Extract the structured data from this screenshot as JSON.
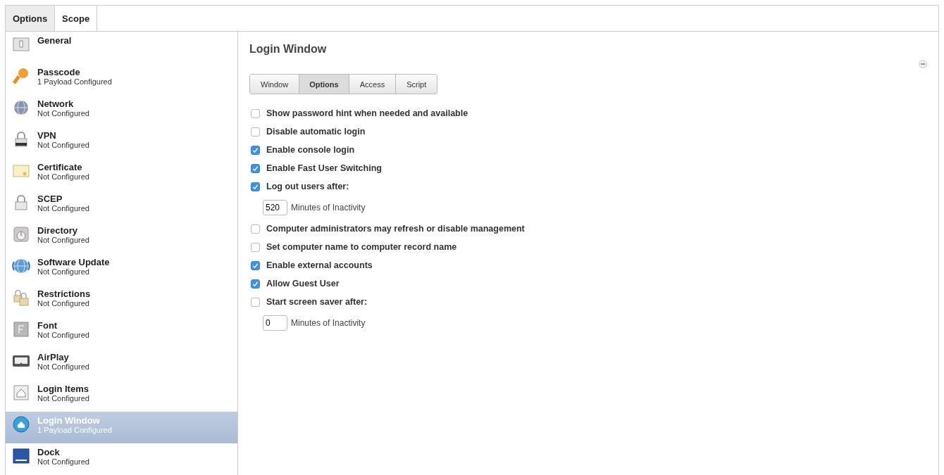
{
  "top_tabs": [
    {
      "label": "Options",
      "selected": true
    },
    {
      "label": "Scope",
      "selected": false
    }
  ],
  "sidebar": {
    "items": [
      {
        "name": "General",
        "selected": false
      },
      {
        "name": "Passcode",
        "status": "1 Payload Configured",
        "selected": false
      },
      {
        "name": "Network",
        "status": "Not Configured",
        "selected": false
      },
      {
        "name": "VPN",
        "status": "Not Configured",
        "selected": false
      },
      {
        "name": "Certificate",
        "status": "Not Configured",
        "selected": false
      },
      {
        "name": "SCEP",
        "status": "Not Configured",
        "selected": false
      },
      {
        "name": "Directory",
        "status": "Not Configured",
        "selected": false
      },
      {
        "name": "Software Update",
        "status": "Not Configured",
        "selected": false
      },
      {
        "name": "Restrictions",
        "status": "Not Configured",
        "selected": false
      },
      {
        "name": "Font",
        "status": "Not Configured",
        "selected": false
      },
      {
        "name": "AirPlay",
        "status": "Not Configured",
        "selected": false
      },
      {
        "name": "Login Items",
        "status": "Not Configured",
        "selected": false
      },
      {
        "name": "Login Window",
        "status": "1 Payload Configured",
        "selected": true
      },
      {
        "name": "Dock",
        "status": "Not Configured",
        "selected": false
      }
    ]
  },
  "panel": {
    "title": "Login Window",
    "tabs": [
      {
        "label": "Window",
        "selected": false
      },
      {
        "label": "Options",
        "selected": true
      },
      {
        "label": "Access",
        "selected": false
      },
      {
        "label": "Script",
        "selected": false
      }
    ],
    "options": [
      {
        "kind": "checkbox",
        "label": "Show password hint when needed and available",
        "checked": false
      },
      {
        "kind": "checkbox",
        "label": "Disable automatic login",
        "checked": false
      },
      {
        "kind": "checkbox",
        "label": "Enable console login",
        "checked": true
      },
      {
        "kind": "checkbox",
        "label": "Enable Fast User Switching",
        "checked": true
      },
      {
        "kind": "checkbox",
        "label": "Log out users after:",
        "checked": true
      },
      {
        "kind": "minutes",
        "value": "520",
        "label": "Minutes of Inactivity"
      },
      {
        "kind": "checkbox",
        "label": "Computer administrators may refresh or disable management",
        "checked": false
      },
      {
        "kind": "checkbox",
        "label": "Set computer name to computer record name",
        "checked": false
      },
      {
        "kind": "checkbox",
        "label": "Enable external accounts",
        "checked": true
      },
      {
        "kind": "checkbox",
        "label": "Allow Guest User",
        "checked": true
      },
      {
        "kind": "checkbox",
        "label": "Start screen saver after:",
        "checked": false
      },
      {
        "kind": "minutes",
        "value": "0",
        "label": "Minutes of Inactivity"
      }
    ]
  }
}
